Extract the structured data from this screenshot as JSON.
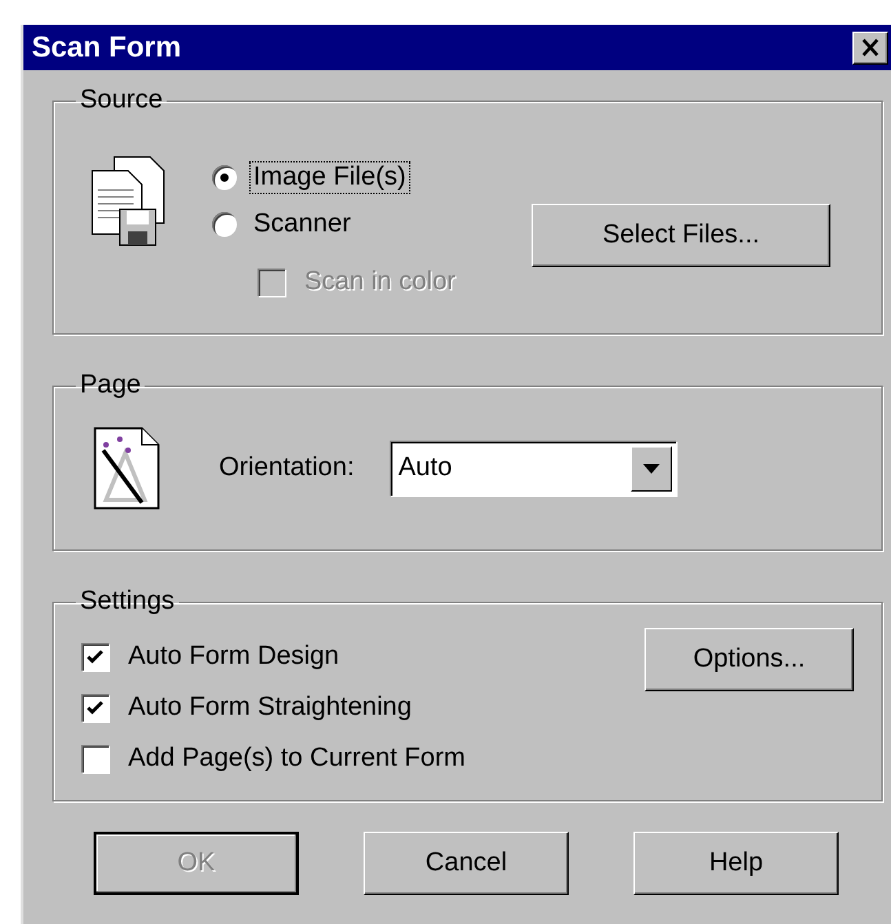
{
  "window": {
    "title": "Scan Form"
  },
  "source": {
    "legend": "Source",
    "radios": [
      {
        "label": "Image File(s)",
        "selected": true,
        "focused": true
      },
      {
        "label": "Scanner",
        "selected": false,
        "focused": false
      }
    ],
    "scan_in_color": {
      "label": "Scan in color",
      "checked": false,
      "disabled": true
    },
    "select_button": "Select Files..."
  },
  "page": {
    "legend": "Page",
    "label": "Orientation:",
    "dropdown": {
      "value": "Auto"
    }
  },
  "settings": {
    "legend": "Settings",
    "checkboxes": [
      {
        "label": "Auto Form Design",
        "checked": true
      },
      {
        "label": "Auto Form Straightening",
        "checked": true
      },
      {
        "label": "Add Page(s) to Current Form",
        "checked": false
      }
    ],
    "options_button": "Options..."
  },
  "buttons": [
    {
      "label": "OK",
      "disabled": true,
      "default": true
    },
    {
      "label": "Cancel",
      "disabled": false,
      "default": false
    },
    {
      "label": "Help",
      "disabled": false,
      "default": false
    }
  ]
}
